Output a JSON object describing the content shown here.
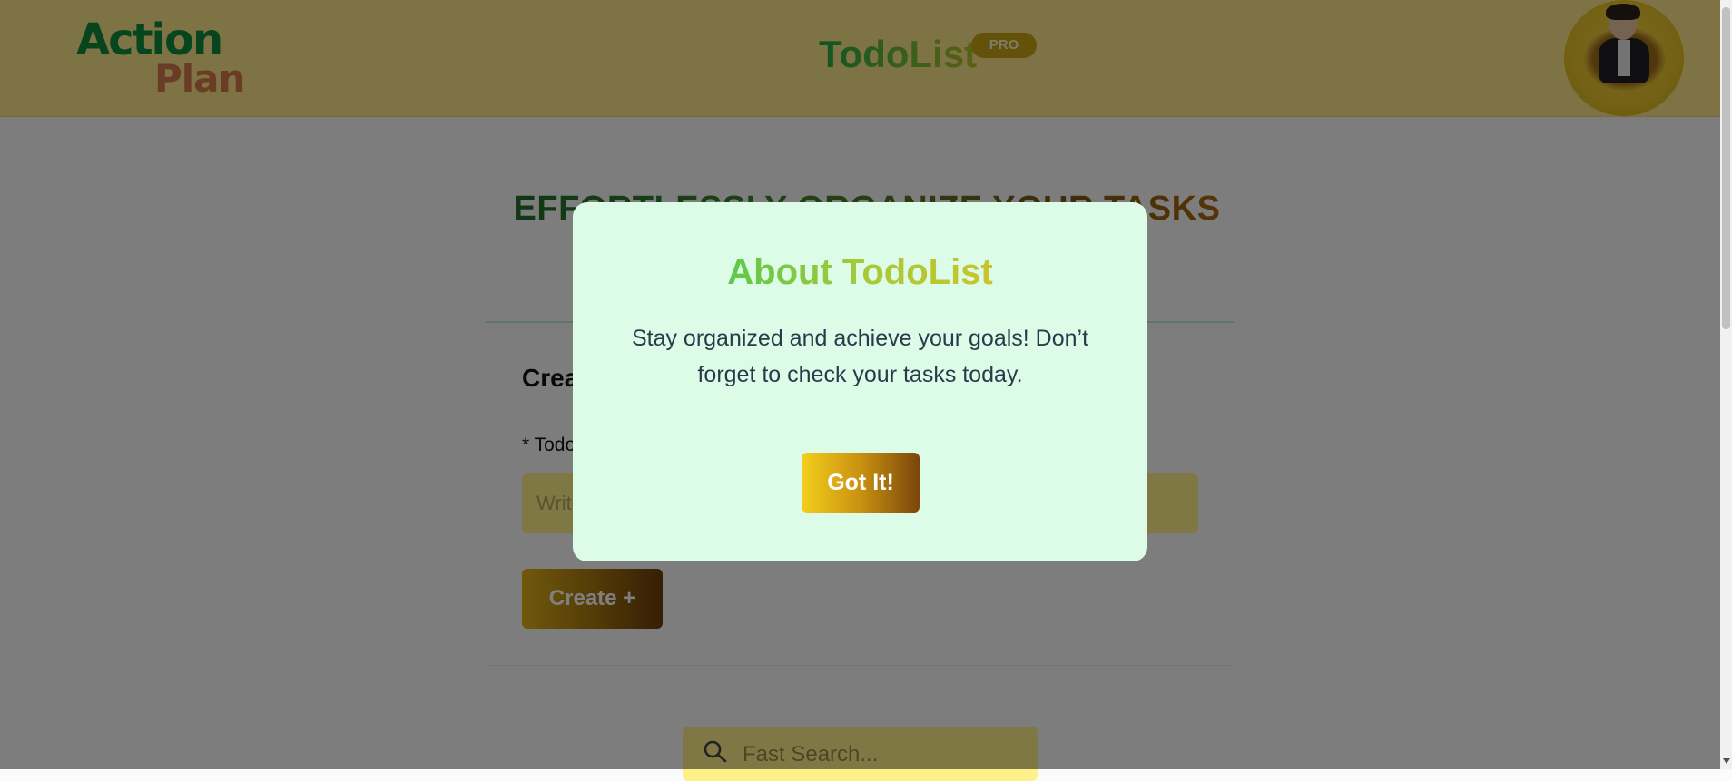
{
  "header": {
    "logo_line1": "Action",
    "logo_line2": "Plan",
    "brand_title": "TodoList",
    "badge": "PRO",
    "avatar_alt": "user avatar"
  },
  "main": {
    "hero_title": "EFFORTLESSLY ORGANIZE YOUR TASKS",
    "create_heading": "Create",
    "field_label": "* Todo",
    "todo_placeholder": "Write",
    "create_button": "Create +",
    "search_placeholder": "Fast Search..."
  },
  "modal": {
    "title": "About TodoList",
    "body": "Stay organized and achieve your goals! Don’t forget to check your tasks today.",
    "button": "Got It!"
  },
  "colors": {
    "header_bg": "#fde68a",
    "input_bg": "#fef08a",
    "modal_bg": "#dcfce7",
    "logo_green": "#0f8a3c",
    "logo_orange": "#d4764a"
  },
  "icons": [
    "search-icon",
    "chevron-down-icon"
  ]
}
